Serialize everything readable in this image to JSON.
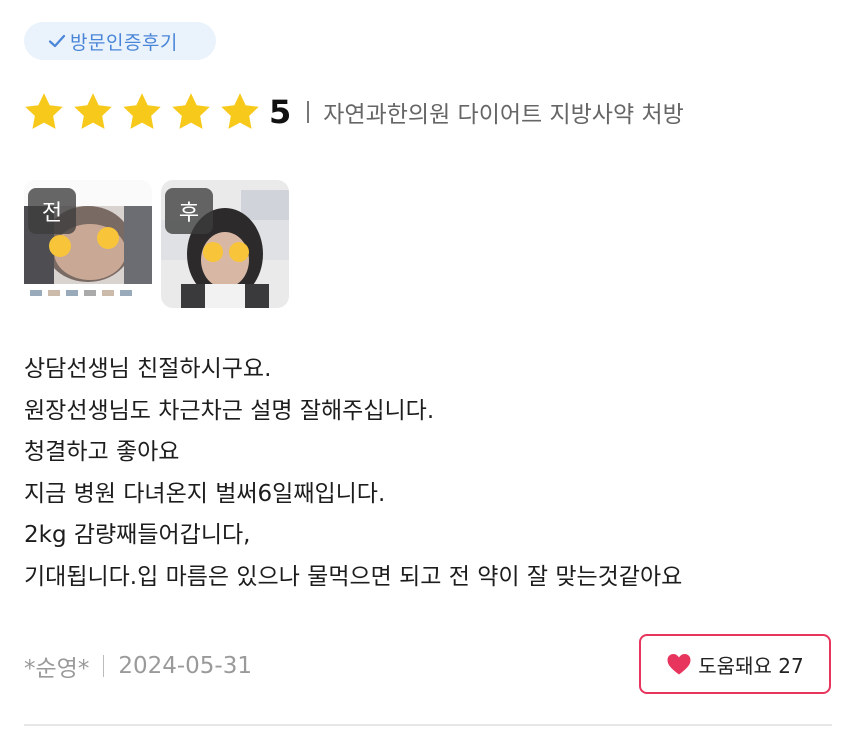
{
  "badge": {
    "label": "방문인증후기",
    "icon": "check-icon"
  },
  "rating": {
    "stars": 5,
    "max_stars": 5,
    "score": "5",
    "product": "자연과한의원 다이어트 지방사약 처방",
    "star_color": "#f7c91a"
  },
  "photos": [
    {
      "tag": "전"
    },
    {
      "tag": "후"
    }
  ],
  "review": {
    "lines": [
      "상담선생님 친절하시구요.",
      "원장선생님도 차근차근 설명 잘해주십니다.",
      "청결하고 좋아요",
      "지금 병원 다녀온지 벌써6일째입니다.",
      "2kg 감량째들어갑니다,",
      "기대됩니다.입 마름은 있으나 물먹으면 되고 전 약이 잘 맞는것같아요"
    ]
  },
  "meta": {
    "author": "*순영*",
    "date": "2024-05-31"
  },
  "helpful": {
    "label": "도움돼요 27",
    "heart_color": "#e8355e"
  }
}
